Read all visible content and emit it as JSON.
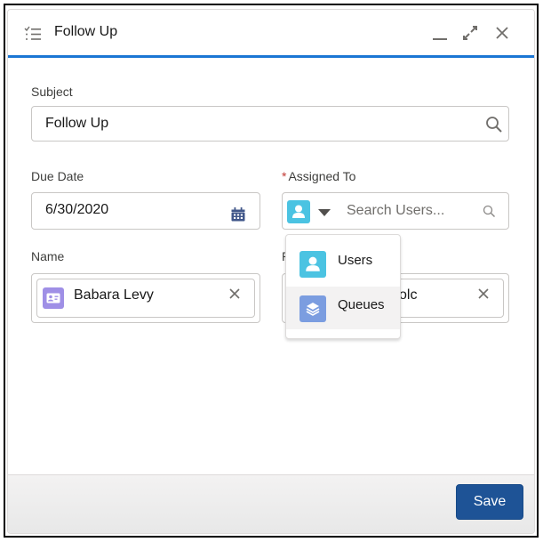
{
  "window": {
    "title": "Follow Up",
    "icons": {
      "header": "task-list-icon",
      "minimize": "minimize-icon",
      "expand": "expand-icon",
      "close": "close-icon"
    }
  },
  "form": {
    "subject": {
      "label": "Subject",
      "value": "Follow Up",
      "icon": "search-icon"
    },
    "due_date": {
      "label": "Due Date",
      "value": "6/30/2020",
      "icon": "calendar-icon"
    },
    "assigned_to": {
      "required_marker": "*",
      "label": "Assigned To",
      "entity_type_icon": "user-icon",
      "placeholder": "Search Users...",
      "icon": "search-icon"
    },
    "name": {
      "label": "Name",
      "pill_label": "Babara Levy",
      "pill_icon": "contact-icon"
    },
    "related_to": {
      "label_visible": "R",
      "pill_label_visible": "olc"
    }
  },
  "entity_dropdown": {
    "items": [
      {
        "label": "Users",
        "icon": "user-icon",
        "color": "#4bc3e2"
      },
      {
        "label": "Queues",
        "icon": "layers-icon",
        "color": "#7b9de0",
        "hovered": true
      }
    ]
  },
  "colors": {
    "accent": "#1b76d4",
    "save_button": "#1e5396",
    "contact_icon": "#9f8fe6",
    "required": "#c23934"
  },
  "footer": {
    "save_label": "Save"
  }
}
